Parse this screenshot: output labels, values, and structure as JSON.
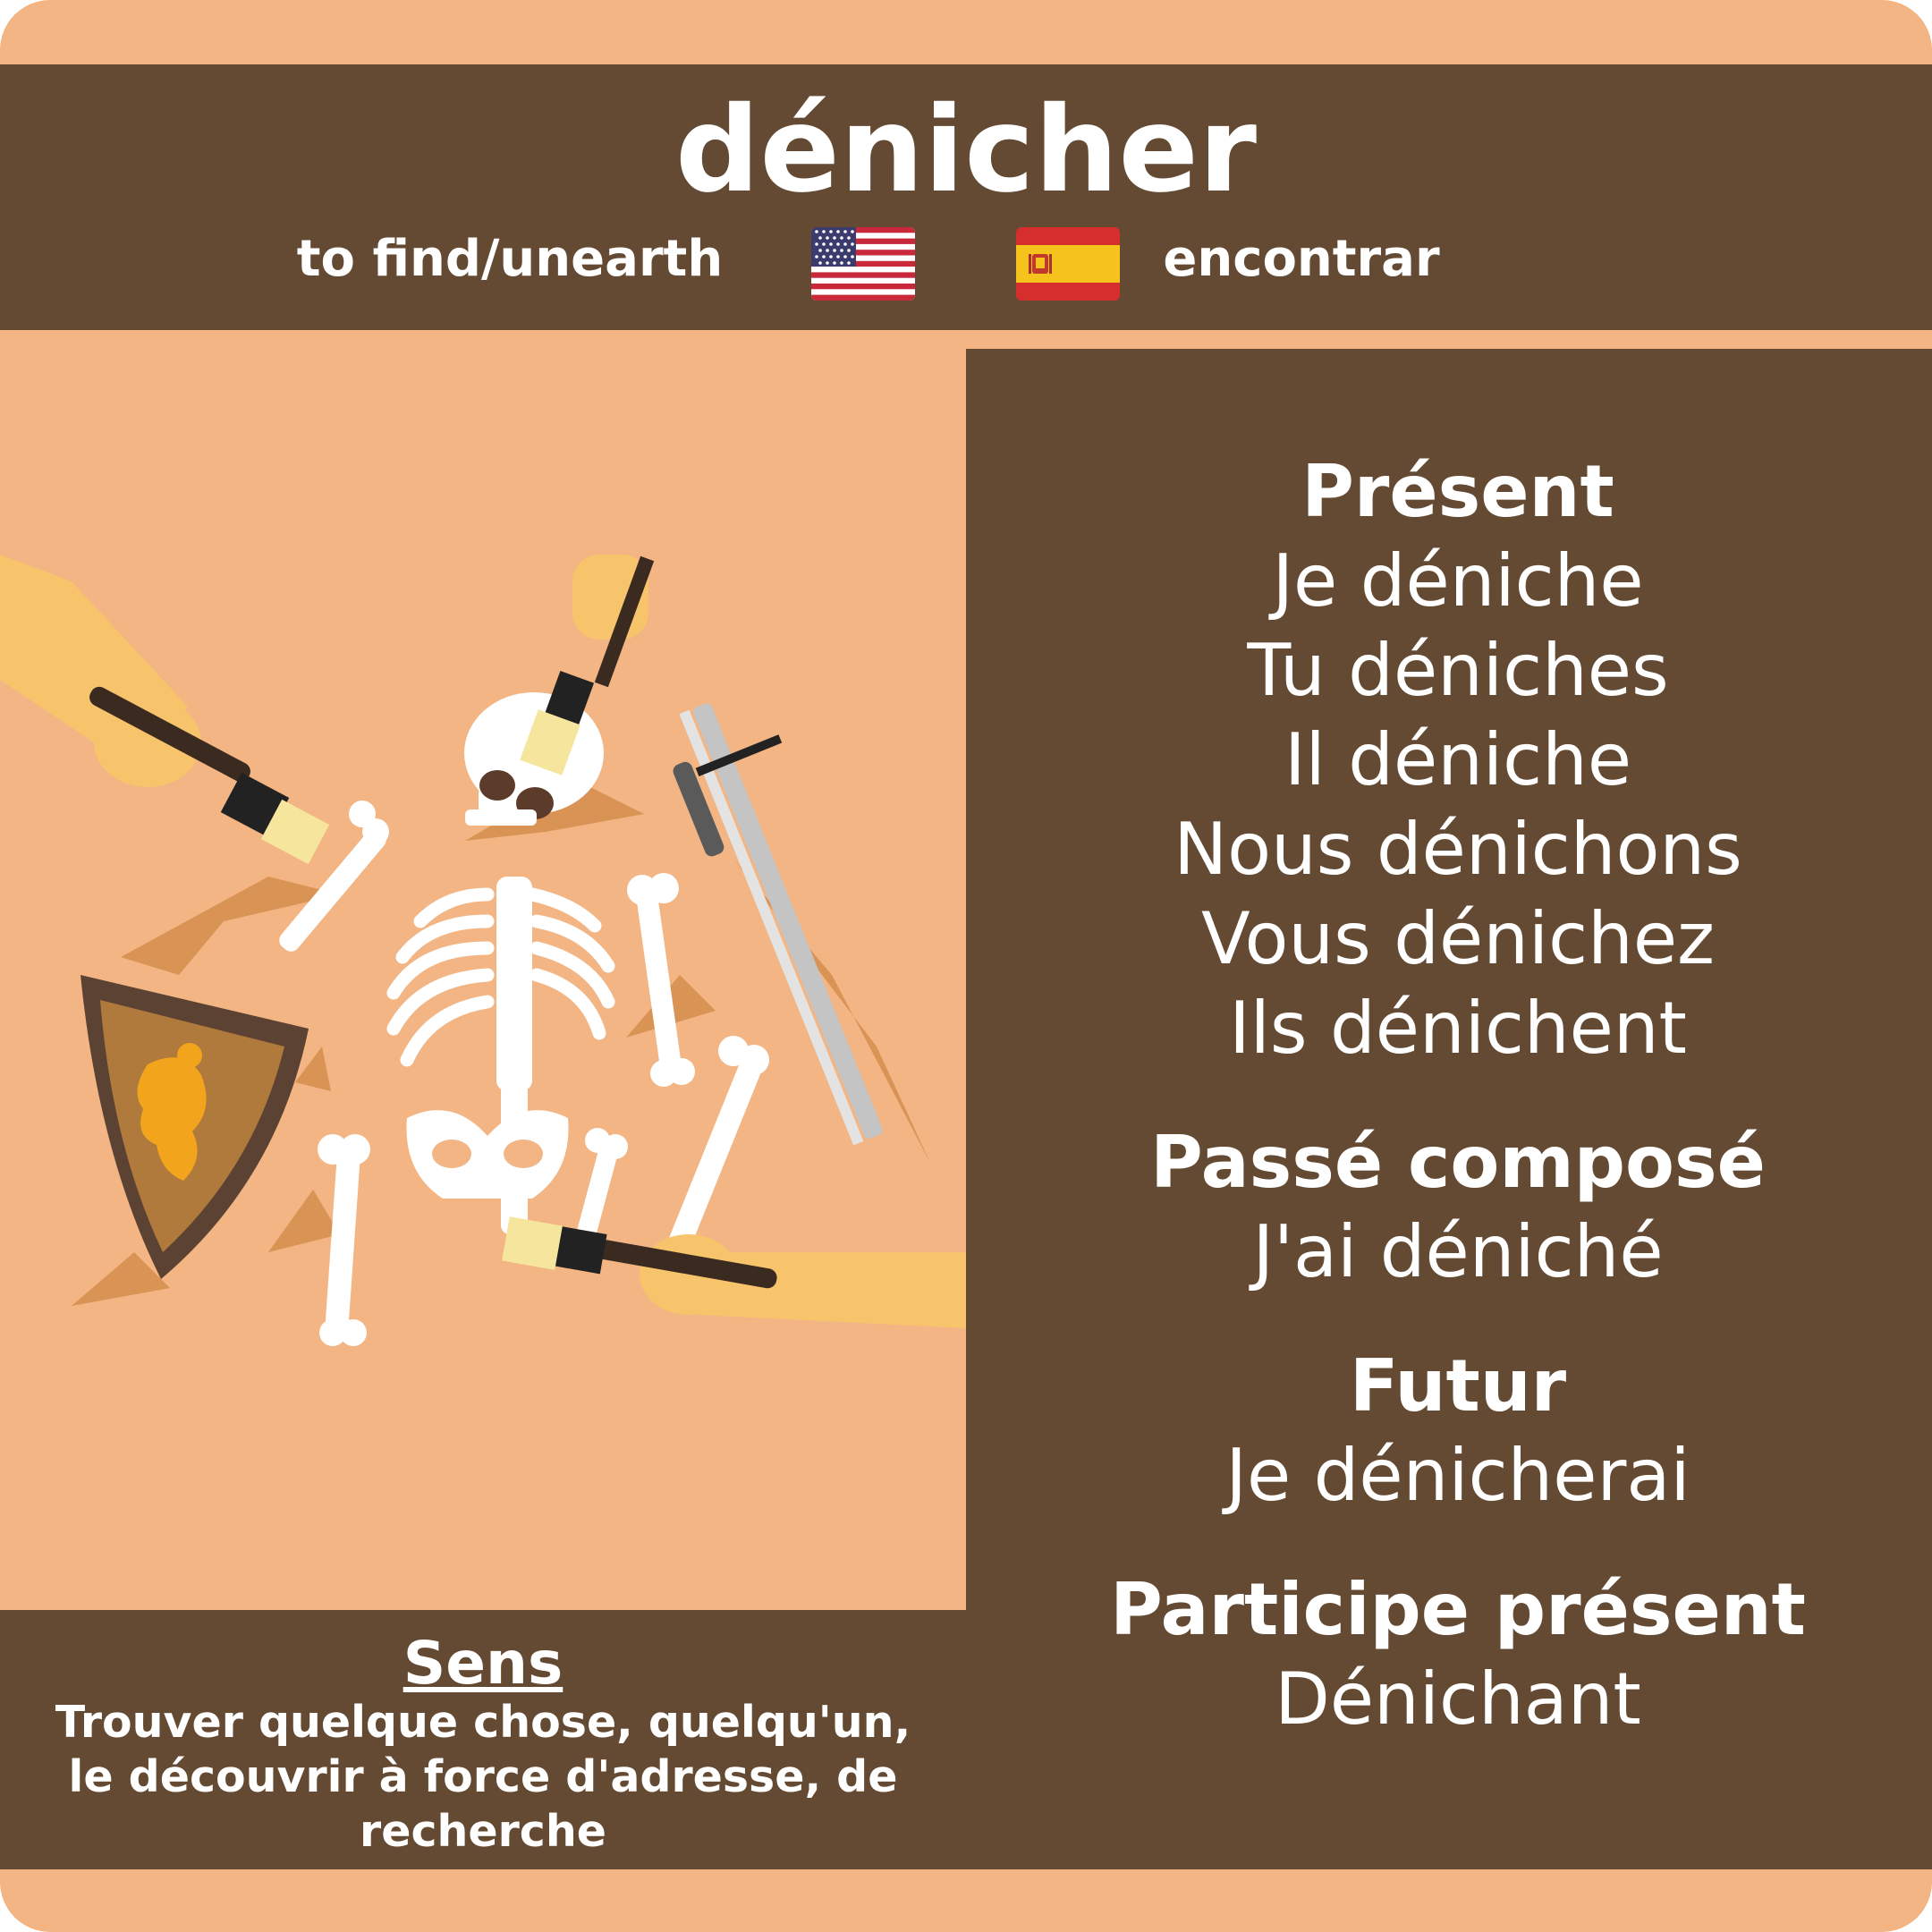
{
  "verb": "dénicher",
  "translations": {
    "english": "to find/unearth",
    "spanish": "encontrar"
  },
  "icons": {
    "english_flag": "us-flag-icon",
    "spanish_flag": "spain-flag-icon",
    "illustration": "archaeology-skeleton-dig-illustration"
  },
  "colors": {
    "background": "#f2b583",
    "panel": "#654a33",
    "text": "#ffffff"
  },
  "conjugation": {
    "present": {
      "title": "Présent",
      "forms": [
        "Je déniche",
        "Tu déniches",
        "Il déniche",
        "Nous dénichons",
        "Vous dénichez",
        "Ils dénichent"
      ]
    },
    "passe_compose": {
      "title": "Passé composé",
      "form": "J'ai déniché"
    },
    "futur": {
      "title": "Futur",
      "form": "Je dénicherai"
    },
    "participe_present": {
      "title": "Participe présent",
      "form": "Dénichant"
    }
  },
  "sens": {
    "title": "Sens",
    "lines": [
      "Trouver quelque chose, quelqu'un,",
      "le découvrir à force d'adresse, de",
      "recherche"
    ]
  }
}
